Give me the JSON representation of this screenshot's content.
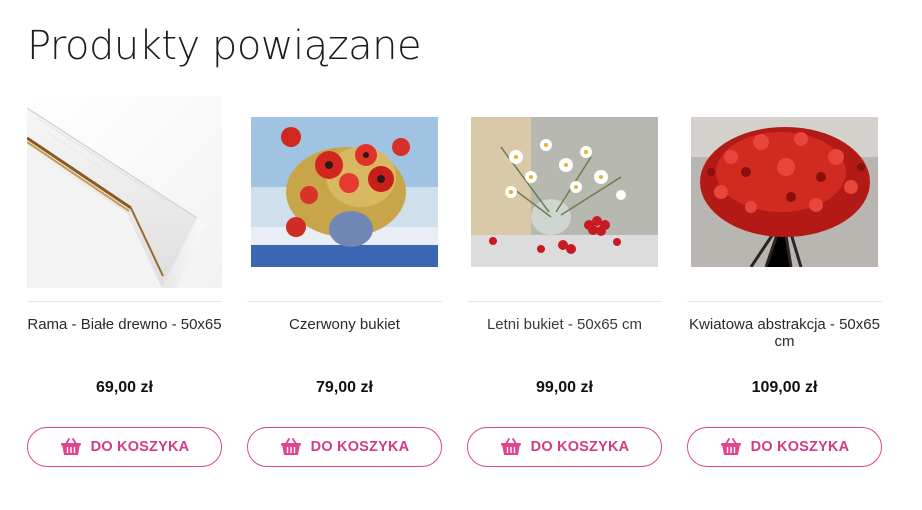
{
  "section": {
    "title": "Produkty powiązane"
  },
  "colors": {
    "accent": "#e0458f",
    "accent_text": "#d43b86"
  },
  "products": [
    {
      "name": "Rama - Białe drewno - 50x65",
      "price": "69,00 zł",
      "image_icon": "white-wood-frame-corner",
      "button_label": "DO KOSZYKA",
      "button_icon": "basket-icon"
    },
    {
      "name": "Czerwony bukiet",
      "price": "79,00 zł",
      "image_icon": "red-poppies-painting",
      "button_label": "DO KOSZYKA",
      "button_icon": "basket-icon"
    },
    {
      "name": "Letni bukiet - 50x65 cm",
      "price": "99,00 zł",
      "image_icon": "daisies-cherries-painting",
      "button_label": "DO KOSZYKA",
      "button_icon": "basket-icon"
    },
    {
      "name": "Kwiatowa abstrakcja - 50x65 cm",
      "price": "109,00 zł",
      "image_icon": "red-flowers-abstract-painting",
      "button_label": "DO KOSZYKA",
      "button_icon": "basket-icon"
    }
  ]
}
